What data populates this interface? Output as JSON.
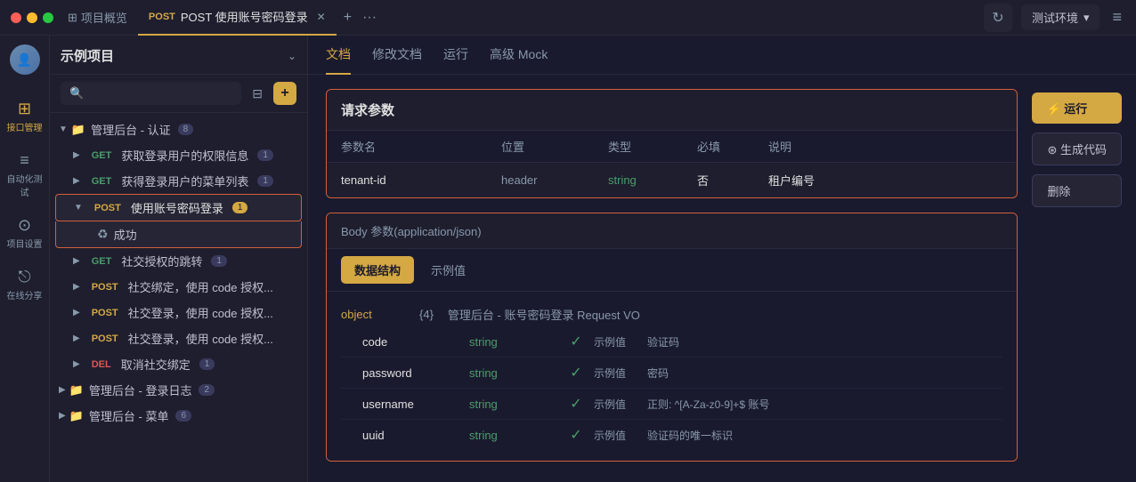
{
  "topbar": {
    "project_tab": "项目概览",
    "active_tab": "POST 使用账号密码登录",
    "refresh_tooltip": "刷新",
    "env_label": "测试环境",
    "dots_label": "···",
    "plus_label": "+"
  },
  "sidebar": {
    "project_title": "示例项目",
    "chevron": "⌄",
    "search_placeholder": "",
    "icons": [
      {
        "key": "api-manage",
        "symbol": "⊞",
        "label": "接口管理",
        "active": true
      },
      {
        "key": "auto-test",
        "symbol": "≡",
        "label": "自动化测试",
        "active": false
      },
      {
        "key": "project-settings",
        "symbol": "⊙",
        "label": "项目设置",
        "active": false
      },
      {
        "key": "share",
        "symbol": "⎋",
        "label": "在线分享",
        "active": false
      }
    ]
  },
  "nav": {
    "folder1": {
      "label": "管理后台 - 认证",
      "count": "8"
    },
    "items": [
      {
        "method": "GET",
        "label": "获取登录用户的权限信息",
        "count": "1"
      },
      {
        "method": "GET",
        "label": "获得登录用户的菜单列表",
        "count": "1"
      },
      {
        "method": "POST",
        "label": "使用账号密码登录",
        "count": "1",
        "active": true
      },
      {
        "type": "sub",
        "icon": "♻",
        "label": "成功"
      },
      {
        "method": "GET",
        "label": "社交授权的跳转",
        "count": "1"
      },
      {
        "method": "POST",
        "label": "社交绑定，使用 code 授权...",
        "count": ""
      },
      {
        "method": "POST",
        "label": "社交登录，使用 code 授权...",
        "count": ""
      },
      {
        "method": "POST",
        "label": "社交登录，使用 code 授权...",
        "count": ""
      },
      {
        "method": "DEL",
        "label": "取消社交绑定",
        "count": "1"
      }
    ],
    "folder2": {
      "label": "管理后台 - 登录日志",
      "count": "2"
    },
    "folder3": {
      "label": "管理后台 - 菜单",
      "count": "6"
    }
  },
  "secondary_tabs": {
    "tabs": [
      "文档",
      "修改文档",
      "运行",
      "高级 Mock"
    ],
    "active": "文档"
  },
  "action_buttons": {
    "run": "⚡ 运行",
    "codegen": "⊛ 生成代码",
    "delete": "删除"
  },
  "request_params": {
    "title": "请求参数",
    "columns": [
      "参数名",
      "位置",
      "类型",
      "必填",
      "说明"
    ],
    "rows": [
      {
        "name": "tenant-id",
        "position": "header",
        "type": "string",
        "required": "否",
        "description": "租户编号"
      }
    ]
  },
  "body_params": {
    "section_label": "Body 参数(application/json)",
    "tabs": [
      "数据结构",
      "示例值"
    ],
    "active_tab": "数据结构",
    "object_key": "object",
    "object_count": "{4}",
    "object_desc": "管理后台 - 账号密码登录 Request VO",
    "fields": [
      {
        "name": "code",
        "type": "string",
        "checked": true,
        "example_label": "示例值",
        "example_value": "验证码"
      },
      {
        "name": "password",
        "type": "string",
        "checked": true,
        "example_label": "示例值",
        "example_value": "密码"
      },
      {
        "name": "username",
        "type": "string",
        "checked": true,
        "example_label": "示例值",
        "example_value": "正则: ^[A-Za-z0-9]+$  账号"
      },
      {
        "name": "uuid",
        "type": "string",
        "checked": true,
        "example_label": "示例值",
        "example_value": "验证码的唯一标识"
      }
    ]
  }
}
